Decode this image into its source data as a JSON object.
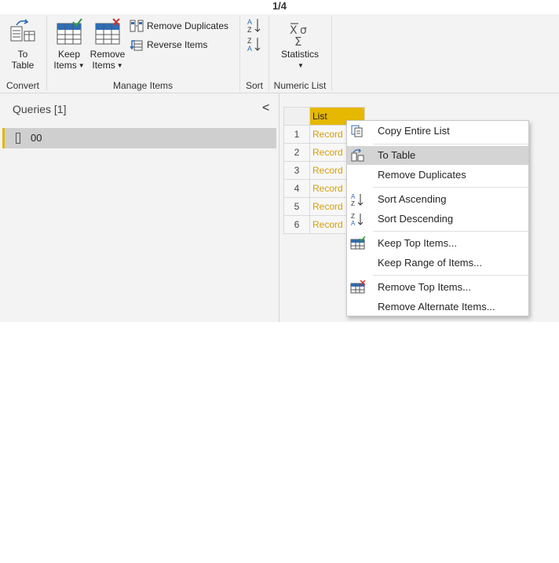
{
  "page_counter": "1/4",
  "ribbon": {
    "convert": {
      "button": "To\nTable",
      "button_l1": "To",
      "button_l2": "Table",
      "group_label": "Convert"
    },
    "manage": {
      "keep_l1": "Keep",
      "keep_l2": "Items",
      "remove_l1": "Remove",
      "remove_l2": "Items",
      "remove_duplicates": "Remove Duplicates",
      "reverse_items": "Reverse Items",
      "group_label": "Manage Items"
    },
    "sort": {
      "group_label": "Sort"
    },
    "numeric": {
      "statistics": "Statistics",
      "group_label": "Numeric List"
    }
  },
  "queries": {
    "title": "Queries [1]",
    "collapse": "<",
    "items": [
      {
        "label": "00"
      }
    ]
  },
  "grid": {
    "column_header": "List",
    "rows": [
      {
        "num": "1",
        "value": "Record"
      },
      {
        "num": "2",
        "value": "Record"
      },
      {
        "num": "3",
        "value": "Record"
      },
      {
        "num": "4",
        "value": "Record"
      },
      {
        "num": "5",
        "value": "Record"
      },
      {
        "num": "6",
        "value": "Record"
      }
    ]
  },
  "context_menu": {
    "copy_entire_list": "Copy Entire List",
    "to_table": "To Table",
    "remove_duplicates": "Remove Duplicates",
    "sort_ascending": "Sort Ascending",
    "sort_descending": "Sort Descending",
    "keep_top_items": "Keep Top Items...",
    "keep_range_of_items": "Keep Range of Items...",
    "remove_top_items": "Remove Top Items...",
    "remove_alternate_items": "Remove Alternate Items..."
  },
  "colors": {
    "accent": "#e6b800",
    "record_link": "#d69e0a",
    "icon_blue": "#2f6db5",
    "icon_red": "#c8372d"
  }
}
